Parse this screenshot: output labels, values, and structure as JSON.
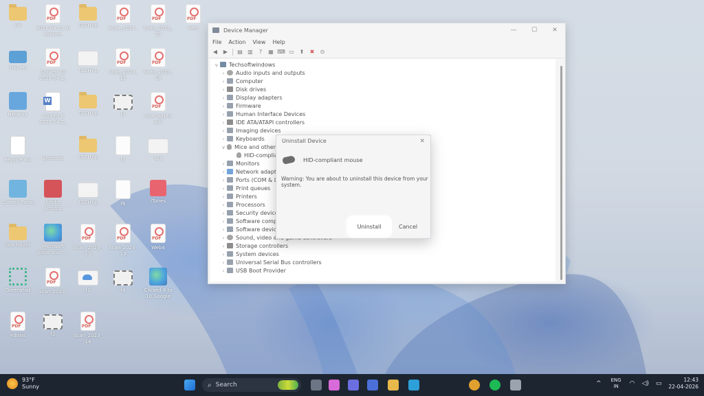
{
  "desktop": {
    "icons": [
      {
        "label": "Fol",
        "kind": "folder"
      },
      {
        "label": "2023-04-22 3i eknone",
        "kind": "pdf"
      },
      {
        "label": "TECHY.p",
        "kind": "folder"
      },
      {
        "label": "Scan_2023..",
        "kind": "pdf"
      },
      {
        "label": "Scan_2023_ 19",
        "kind": "pdf"
      },
      {
        "label": "Web",
        "kind": "pdf"
      },
      {
        "label": "This PC",
        "kind": "pc"
      },
      {
        "label": "Clicked 10 2023-04-2_",
        "kind": "pdf"
      },
      {
        "label": "TECHY.p",
        "kind": "img"
      },
      {
        "label": "Scan_2023_ 15",
        "kind": "pdf"
      },
      {
        "label": "Scan_2023_ 18",
        "kind": "pdf"
      },
      {
        "label": "Network",
        "kind": "net"
      },
      {
        "label": "Clicked 8 2023-04-2_",
        "kind": "word"
      },
      {
        "label": "TECHY.p",
        "kind": "folder"
      },
      {
        "label": "f1",
        "kind": "film"
      },
      {
        "label": "how output pdf",
        "kind": "pdf"
      },
      {
        "label": "Recycle Bin",
        "kind": "bin"
      },
      {
        "label": "Shortcut",
        "kind": "s"
      },
      {
        "label": "TECHY.p",
        "kind": "folder"
      },
      {
        "label": "f3",
        "kind": "doc"
      },
      {
        "label": "f34",
        "kind": "img"
      },
      {
        "label": "Control Panel",
        "kind": "cp"
      },
      {
        "label": "Adobe Acrobat",
        "kind": "acro"
      },
      {
        "label": "TECHY.p",
        "kind": "img"
      },
      {
        "label": "f6",
        "kind": "doc"
      },
      {
        "label": "iTunes",
        "kind": "music"
      },
      {
        "label": "Gr8 Folder",
        "kind": "folder"
      },
      {
        "label": "Microsoft Edge your ...",
        "kind": "edge"
      },
      {
        "label": "Scan_2023_ 13",
        "kind": "pdf"
      },
      {
        "label": "Scan_2023_ 13",
        "kind": "pdf"
      },
      {
        "label": "Web4",
        "kind": "pdf"
      },
      {
        "label": "Greenshot",
        "kind": "green"
      },
      {
        "label": "Scan_2023_",
        "kind": "pdf"
      },
      {
        "label": "f1",
        "kind": "cloud"
      },
      {
        "label": "f4",
        "kind": "film"
      },
      {
        "label": "Clicked 8 to 10 Google",
        "kind": "edge"
      },
      {
        "label": "edited",
        "kind": "pdf"
      },
      {
        "label": "f2",
        "kind": "film"
      },
      {
        "label": "Scan_2023_ 14",
        "kind": "pdf"
      }
    ]
  },
  "device_manager": {
    "title": "Device Manager",
    "window_buttons": {
      "minimize": "—",
      "maximize": "☐",
      "close": "✕"
    },
    "menu": [
      "File",
      "Action",
      "View",
      "Help"
    ],
    "toolbar": [
      "back",
      "forward",
      "properties",
      "help",
      "scan",
      "device",
      "monitor",
      "remove-icon",
      "disable-icon",
      "update-icon"
    ],
    "root": "Techsoftwindows",
    "categories": [
      {
        "label": "Audio inputs and outputs",
        "icon": "sound"
      },
      {
        "label": "Computer",
        "icon": "pc"
      },
      {
        "label": "Disk drives",
        "icon": "disk"
      },
      {
        "label": "Display adapters",
        "icon": "pc"
      },
      {
        "label": "Firmware",
        "icon": "pc"
      },
      {
        "label": "Human Interface Devices",
        "icon": "pc"
      },
      {
        "label": "IDE ATA/ATAPI controllers",
        "icon": "disk"
      },
      {
        "label": "Imaging devices",
        "icon": "pc"
      },
      {
        "label": "Keyboards",
        "icon": "pc"
      },
      {
        "label": "Mice and other",
        "icon": "mouse",
        "expanded": true
      },
      {
        "label": "HID-complia",
        "icon": "mouse",
        "child": true
      },
      {
        "label": "Monitors",
        "icon": "pc"
      },
      {
        "label": "Network adapte",
        "icon": "net"
      },
      {
        "label": "Ports (COM & L",
        "icon": "pc"
      },
      {
        "label": "Print queues",
        "icon": "pc"
      },
      {
        "label": "Printers",
        "icon": "pc"
      },
      {
        "label": "Processors",
        "icon": "pc"
      },
      {
        "label": "Security device",
        "icon": "pc"
      },
      {
        "label": "Software compo",
        "icon": "pc"
      },
      {
        "label": "Software device",
        "icon": "pc"
      },
      {
        "label": "Sound, video and game controllers",
        "icon": "sound"
      },
      {
        "label": "Storage controllers",
        "icon": "disk"
      },
      {
        "label": "System devices",
        "icon": "pc"
      },
      {
        "label": "Universal Serial Bus controllers",
        "icon": "pc"
      },
      {
        "label": "USB Boot Provider",
        "icon": "pc"
      }
    ]
  },
  "uninstall_dialog": {
    "title": "Uninstall Device",
    "close": "✕",
    "device_name": "HID-compliant mouse",
    "warning": "Warning: You are about to uninstall this device from your system.",
    "uninstall_label": "Uninstall",
    "cancel_label": "Cancel"
  },
  "taskbar": {
    "weather_temp": "93°F",
    "weather_desc": "Sunny",
    "search_placeholder": "Search",
    "apps": [
      "file-explorer",
      "copilot",
      "teams",
      "store",
      "folder",
      "skype",
      "chrome",
      "spotify",
      "misc"
    ],
    "tray": {
      "lang1": "ENG",
      "lang2": "IN",
      "time": "12:43",
      "date": "22-04-2026"
    }
  },
  "colors": {
    "taskbar": "#1d2531",
    "window": "#f3f3f3",
    "accent": "#1e6fd1"
  }
}
